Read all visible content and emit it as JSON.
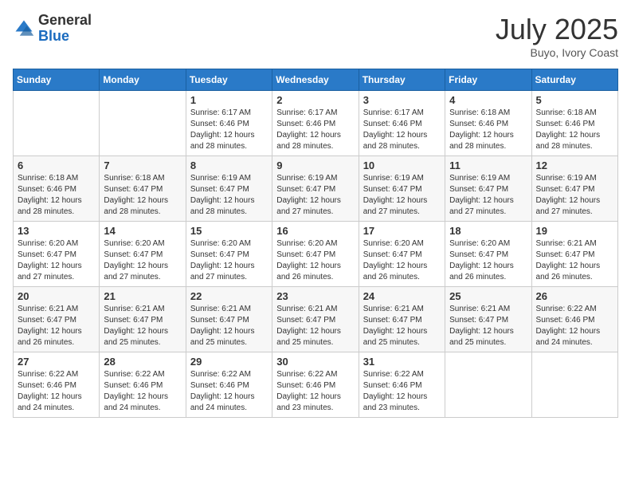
{
  "logo": {
    "general": "General",
    "blue": "Blue"
  },
  "header": {
    "month": "July 2025",
    "location": "Buyo, Ivory Coast"
  },
  "days_of_week": [
    "Sunday",
    "Monday",
    "Tuesday",
    "Wednesday",
    "Thursday",
    "Friday",
    "Saturday"
  ],
  "weeks": [
    [
      {
        "day": "",
        "info": ""
      },
      {
        "day": "",
        "info": ""
      },
      {
        "day": "1",
        "info": "Sunrise: 6:17 AM\nSunset: 6:46 PM\nDaylight: 12 hours and 28 minutes."
      },
      {
        "day": "2",
        "info": "Sunrise: 6:17 AM\nSunset: 6:46 PM\nDaylight: 12 hours and 28 minutes."
      },
      {
        "day": "3",
        "info": "Sunrise: 6:17 AM\nSunset: 6:46 PM\nDaylight: 12 hours and 28 minutes."
      },
      {
        "day": "4",
        "info": "Sunrise: 6:18 AM\nSunset: 6:46 PM\nDaylight: 12 hours and 28 minutes."
      },
      {
        "day": "5",
        "info": "Sunrise: 6:18 AM\nSunset: 6:46 PM\nDaylight: 12 hours and 28 minutes."
      }
    ],
    [
      {
        "day": "6",
        "info": "Sunrise: 6:18 AM\nSunset: 6:46 PM\nDaylight: 12 hours and 28 minutes."
      },
      {
        "day": "7",
        "info": "Sunrise: 6:18 AM\nSunset: 6:47 PM\nDaylight: 12 hours and 28 minutes."
      },
      {
        "day": "8",
        "info": "Sunrise: 6:19 AM\nSunset: 6:47 PM\nDaylight: 12 hours and 28 minutes."
      },
      {
        "day": "9",
        "info": "Sunrise: 6:19 AM\nSunset: 6:47 PM\nDaylight: 12 hours and 27 minutes."
      },
      {
        "day": "10",
        "info": "Sunrise: 6:19 AM\nSunset: 6:47 PM\nDaylight: 12 hours and 27 minutes."
      },
      {
        "day": "11",
        "info": "Sunrise: 6:19 AM\nSunset: 6:47 PM\nDaylight: 12 hours and 27 minutes."
      },
      {
        "day": "12",
        "info": "Sunrise: 6:19 AM\nSunset: 6:47 PM\nDaylight: 12 hours and 27 minutes."
      }
    ],
    [
      {
        "day": "13",
        "info": "Sunrise: 6:20 AM\nSunset: 6:47 PM\nDaylight: 12 hours and 27 minutes."
      },
      {
        "day": "14",
        "info": "Sunrise: 6:20 AM\nSunset: 6:47 PM\nDaylight: 12 hours and 27 minutes."
      },
      {
        "day": "15",
        "info": "Sunrise: 6:20 AM\nSunset: 6:47 PM\nDaylight: 12 hours and 27 minutes."
      },
      {
        "day": "16",
        "info": "Sunrise: 6:20 AM\nSunset: 6:47 PM\nDaylight: 12 hours and 26 minutes."
      },
      {
        "day": "17",
        "info": "Sunrise: 6:20 AM\nSunset: 6:47 PM\nDaylight: 12 hours and 26 minutes."
      },
      {
        "day": "18",
        "info": "Sunrise: 6:20 AM\nSunset: 6:47 PM\nDaylight: 12 hours and 26 minutes."
      },
      {
        "day": "19",
        "info": "Sunrise: 6:21 AM\nSunset: 6:47 PM\nDaylight: 12 hours and 26 minutes."
      }
    ],
    [
      {
        "day": "20",
        "info": "Sunrise: 6:21 AM\nSunset: 6:47 PM\nDaylight: 12 hours and 26 minutes."
      },
      {
        "day": "21",
        "info": "Sunrise: 6:21 AM\nSunset: 6:47 PM\nDaylight: 12 hours and 25 minutes."
      },
      {
        "day": "22",
        "info": "Sunrise: 6:21 AM\nSunset: 6:47 PM\nDaylight: 12 hours and 25 minutes."
      },
      {
        "day": "23",
        "info": "Sunrise: 6:21 AM\nSunset: 6:47 PM\nDaylight: 12 hours and 25 minutes."
      },
      {
        "day": "24",
        "info": "Sunrise: 6:21 AM\nSunset: 6:47 PM\nDaylight: 12 hours and 25 minutes."
      },
      {
        "day": "25",
        "info": "Sunrise: 6:21 AM\nSunset: 6:47 PM\nDaylight: 12 hours and 25 minutes."
      },
      {
        "day": "26",
        "info": "Sunrise: 6:22 AM\nSunset: 6:46 PM\nDaylight: 12 hours and 24 minutes."
      }
    ],
    [
      {
        "day": "27",
        "info": "Sunrise: 6:22 AM\nSunset: 6:46 PM\nDaylight: 12 hours and 24 minutes."
      },
      {
        "day": "28",
        "info": "Sunrise: 6:22 AM\nSunset: 6:46 PM\nDaylight: 12 hours and 24 minutes."
      },
      {
        "day": "29",
        "info": "Sunrise: 6:22 AM\nSunset: 6:46 PM\nDaylight: 12 hours and 24 minutes."
      },
      {
        "day": "30",
        "info": "Sunrise: 6:22 AM\nSunset: 6:46 PM\nDaylight: 12 hours and 23 minutes."
      },
      {
        "day": "31",
        "info": "Sunrise: 6:22 AM\nSunset: 6:46 PM\nDaylight: 12 hours and 23 minutes."
      },
      {
        "day": "",
        "info": ""
      },
      {
        "day": "",
        "info": ""
      }
    ]
  ]
}
